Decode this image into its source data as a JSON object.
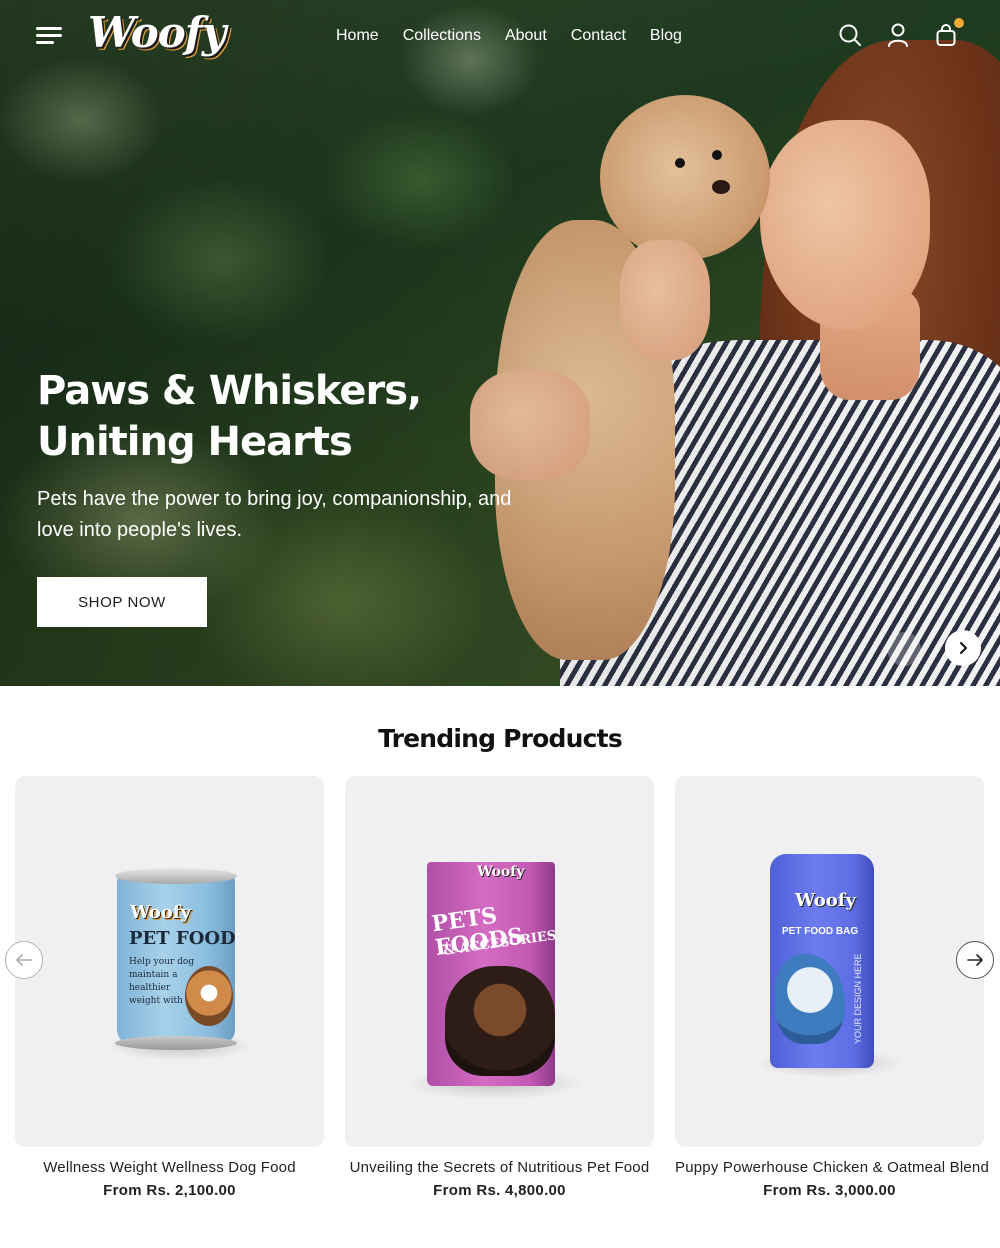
{
  "brand": {
    "logo_text": "Woofy"
  },
  "nav": {
    "items": [
      "Home",
      "Collections",
      "About",
      "Contact",
      "Blog"
    ]
  },
  "header_icons": [
    "menu-icon",
    "search-icon",
    "account-icon",
    "cart-icon"
  ],
  "hero": {
    "title_line1": "Paws & Whiskers,",
    "title_line2": "Uniting Hearts",
    "subtitle": "Pets have the power to bring joy, companionship, and love into people's lives.",
    "cta_label": "SHOP NOW"
  },
  "trending": {
    "title": "Trending Products",
    "products": [
      {
        "name": "Wellness Weight Wellness Dog Food",
        "price": "From Rs. 2,100.00",
        "package": {
          "brand": "Woofy",
          "label": "PET FOOD",
          "tagline": "Help your dog maintain a healthier weight with"
        }
      },
      {
        "name": "Unveiling the Secrets of Nutritious Pet Food",
        "price": "From Rs. 4,800.00",
        "package": {
          "brand": "Woofy",
          "label": "PETS FOODS",
          "sublabel": "& ACCESORIES"
        }
      },
      {
        "name": "Puppy Powerhouse Chicken & Oatmeal Blend",
        "price": "From Rs. 3,000.00",
        "package": {
          "brand": "Woofy",
          "label": "PET FOOD BAG",
          "side_text": "YOUR DESIGN HERE"
        }
      }
    ]
  },
  "colors": {
    "accent": "#f2a93b",
    "card_bg": "#f0f0f2",
    "text_dark": "#1a1a1a"
  }
}
